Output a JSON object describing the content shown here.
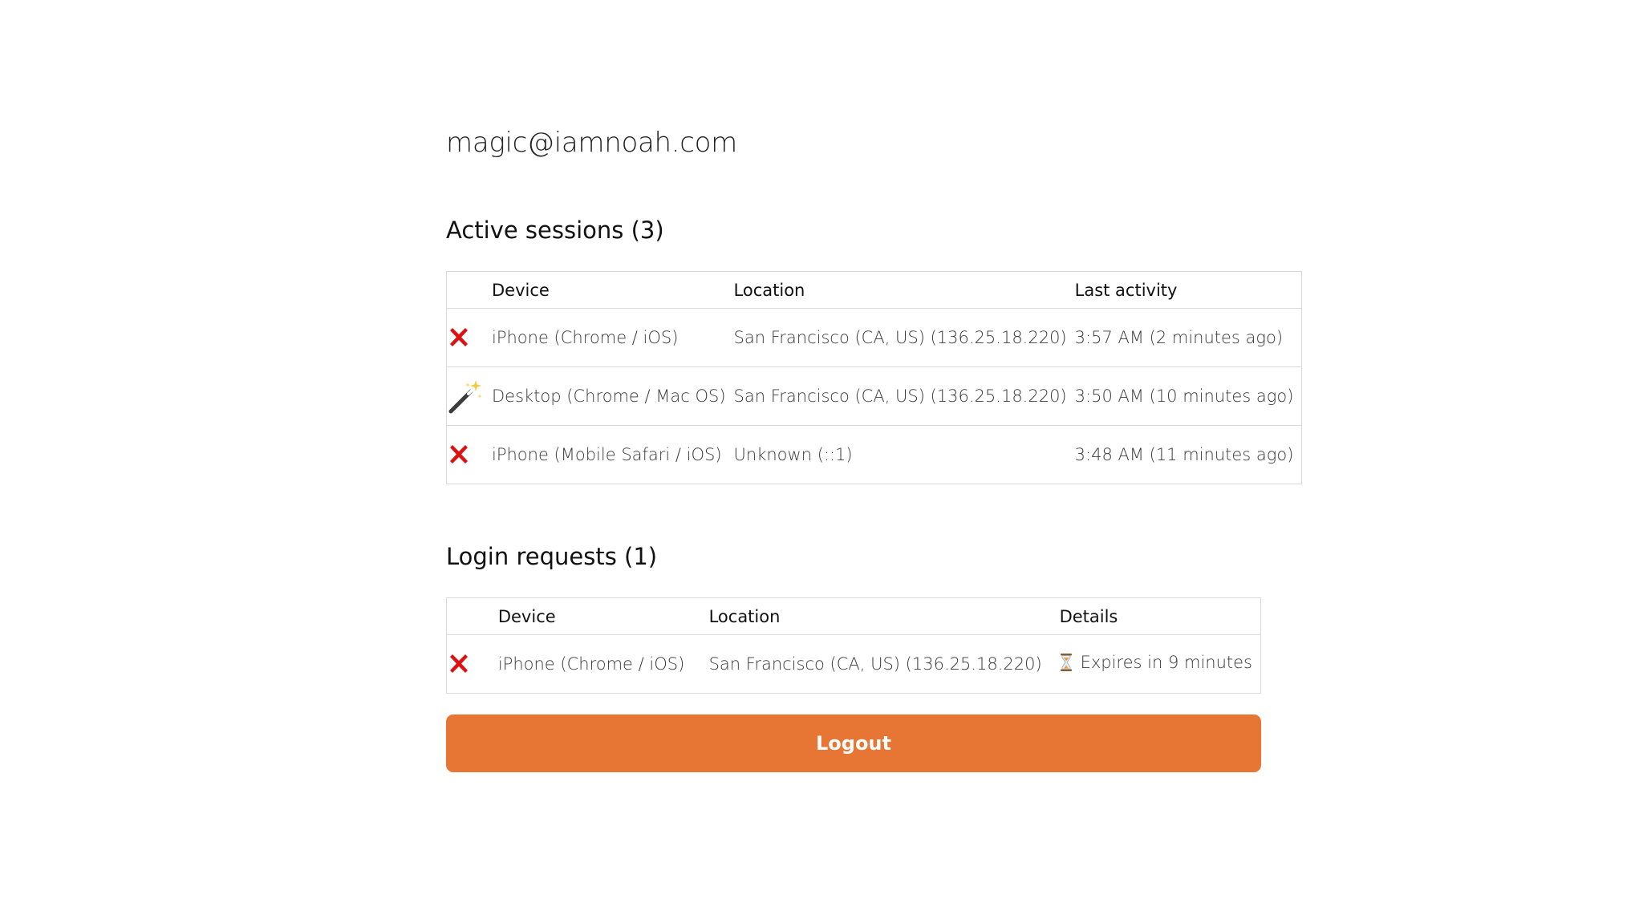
{
  "user": {
    "email": "magic@iamnoah.com"
  },
  "sessions": {
    "title": "Active sessions (3)",
    "headers": {
      "device": "Device",
      "location": "Location",
      "last_activity": "Last activity"
    },
    "rows": [
      {
        "icon": "red-x-icon",
        "device": "iPhone (Chrome / iOS)",
        "location": "San Francisco (CA, US) (136.25.18.220)",
        "last_activity": "3:57 AM (2 minutes ago)"
      },
      {
        "icon": "magic-wand-icon",
        "device": "Desktop (Chrome / Mac OS)",
        "location": "San Francisco (CA, US) (136.25.18.220)",
        "last_activity": "3:50 AM (10 minutes ago)"
      },
      {
        "icon": "red-x-icon",
        "device": "iPhone (Mobile Safari / iOS)",
        "location": "Unknown (::1)",
        "last_activity": "3:48 AM (11 minutes ago)"
      }
    ]
  },
  "requests": {
    "title": "Login requests (1)",
    "headers": {
      "device": "Device",
      "location": "Location",
      "details": "Details"
    },
    "rows": [
      {
        "icon": "red-x-icon",
        "device": "iPhone (Chrome / iOS)",
        "location": "San Francisco (CA, US) (136.25.18.220)",
        "details_icon": "hourglass-icon",
        "details": "Expires in 9 minutes"
      }
    ]
  },
  "logout": {
    "label": "Logout"
  },
  "colors": {
    "accent": "#e77533",
    "danger": "#dd1111",
    "border": "#d9d9d9"
  }
}
